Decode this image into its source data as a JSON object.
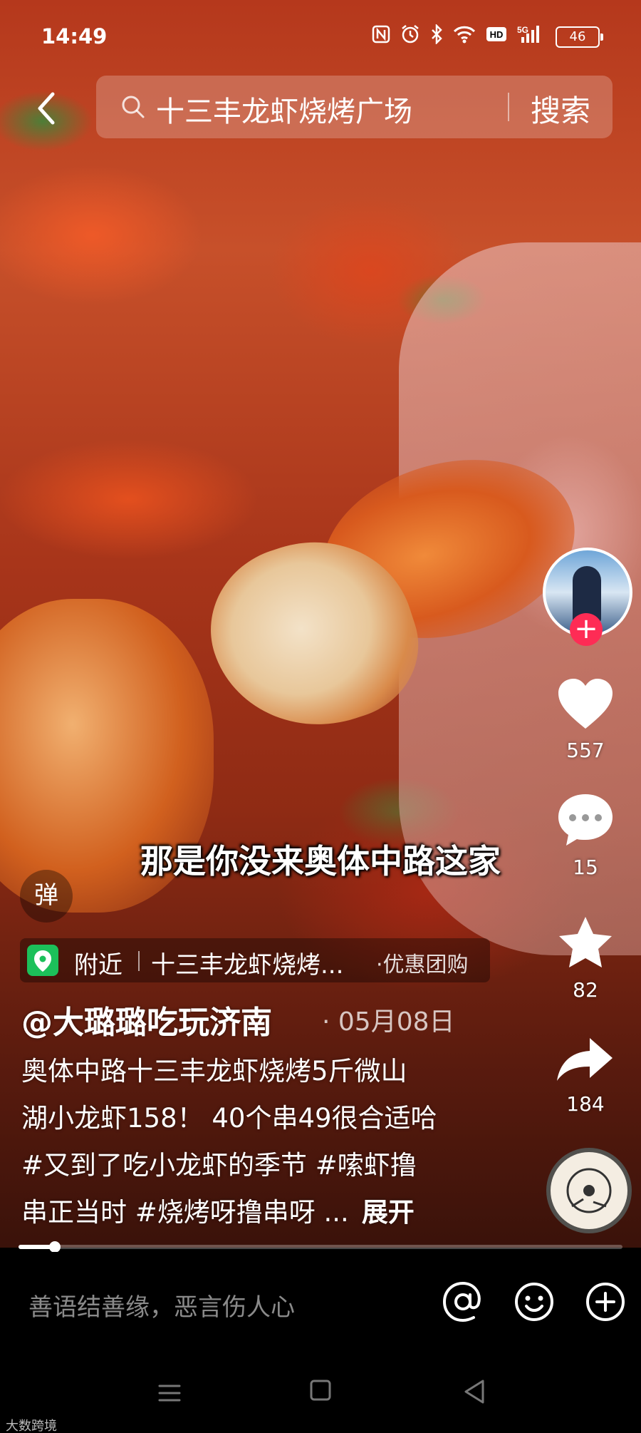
{
  "status_bar": {
    "time": "14:49",
    "icons": [
      "nfc-icon",
      "alarm-icon",
      "bluetooth-icon",
      "wifi-icon",
      "hd-icon",
      "signal-5g-icon"
    ],
    "hd_label": "HD",
    "network_label": "5G",
    "battery": "46"
  },
  "search": {
    "query": "十三丰龙虾烧烤广场",
    "button_label": "搜索"
  },
  "video": {
    "caption": "那是你没来奥体中路这家",
    "progress": 0.06
  },
  "right_rail": {
    "follow_label": "+",
    "likes": "557",
    "comments": "15",
    "favorites": "82",
    "shares": "184"
  },
  "danmaku_label": "弹",
  "location": {
    "nearby": "附近",
    "name": "十三丰龙虾烧烤...",
    "deal": "·优惠团购"
  },
  "post": {
    "author": "@大璐璐吃玩济南",
    "date": "· 05月08日",
    "description_lines": [
      "奥体中路十三丰龙虾烧烤5斤微山",
      "湖小龙虾158！ 40个串49很合适哈",
      "#又到了吃小龙虾的季节 #嗦虾撸",
      "串正当时 #烧烤呀撸串呀 ..."
    ],
    "expand_label": "展开"
  },
  "comment_bar": {
    "placeholder": "善语结善缘，恶言伤人心"
  },
  "watermark": "大数跨境",
  "colors": {
    "follow_red": "#fe2c55",
    "location_green": "#1cc05a",
    "background": "#000000"
  }
}
